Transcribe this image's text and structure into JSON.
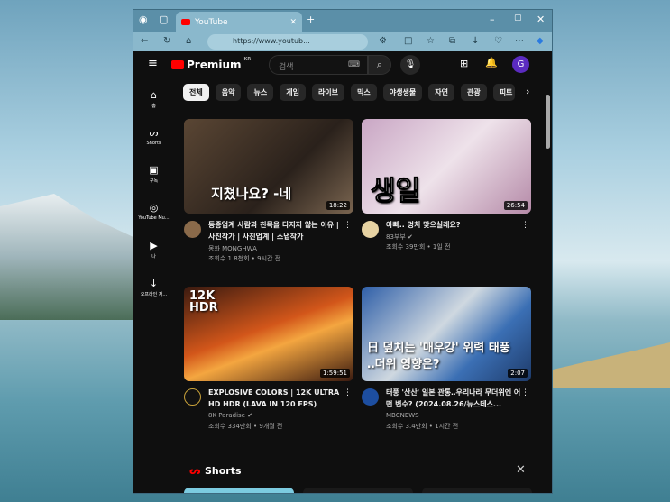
{
  "browser": {
    "tab_title": "YouTube",
    "url": "https://www.youtub..."
  },
  "header": {
    "logo": "Premium",
    "region": "KR",
    "search_placeholder": "검색",
    "avatar_letter": "G"
  },
  "chips": [
    "전체",
    "음악",
    "뉴스",
    "게임",
    "라이브",
    "믹스",
    "야생생물",
    "자연",
    "관광",
    "피트"
  ],
  "sidebar": [
    {
      "icon": "home-icon",
      "label": "홈"
    },
    {
      "icon": "shorts-icon",
      "label": "Shorts"
    },
    {
      "icon": "subscriptions-icon",
      "label": "구독"
    },
    {
      "icon": "youtube-music-icon",
      "label": "YouTube Mu..."
    },
    {
      "icon": "you-icon",
      "label": "나"
    },
    {
      "icon": "download-icon",
      "label": "오프라인 저..."
    }
  ],
  "videos": [
    {
      "title": "동종업계 사람과 친목을 다지지 않는 이유 | 사진작가 | 사진업계 | 스냅작가",
      "channel": "몽화 MONGHWA",
      "stats": "조회수 1.8천회 • 9시간 전",
      "duration": "18:22",
      "overlay": "지쳤나요? -네"
    },
    {
      "title": "아빠.. 멍치 맞으실래요?",
      "channel": "83부부 ✔",
      "stats": "조회수 39만회 • 1일 전",
      "duration": "26:54",
      "overlay": "생일"
    },
    {
      "title": "EXPLOSIVE COLORS | 12K ULTRA HD HDR (LAVA IN 120 FPS)",
      "channel": "8K Paradise ✔",
      "stats": "조회수 334만회 • 9개월 전",
      "duration": "1:59:51",
      "overlay": "12K HDR"
    },
    {
      "title": "태풍 '산산' 일본 관통‥우리나라 무더위엔 어떤 변수? (2024.08.26/뉴스데스...",
      "channel": "MBCNEWS",
      "stats": "조회수 3.4만회 • 1시간 전",
      "duration": "2:07",
      "overlay": "日 덮치는 '매우강' 위력 태풍 ‥더위 영향은?"
    }
  ],
  "shorts": {
    "label": "Shorts"
  }
}
